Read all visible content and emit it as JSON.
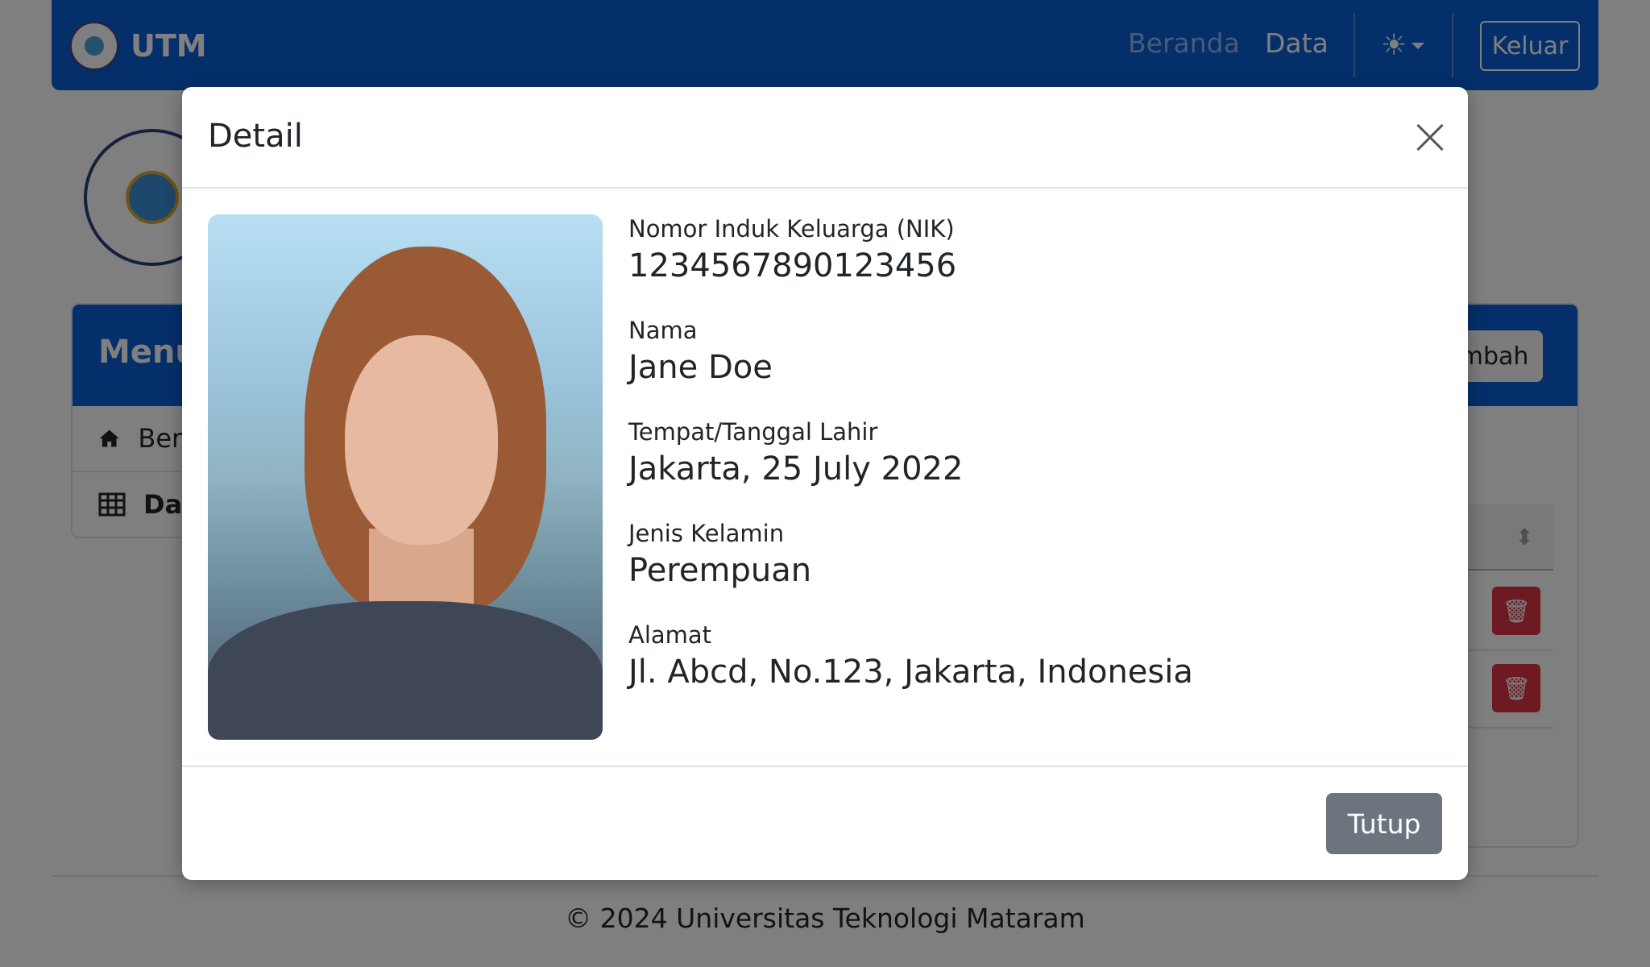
{
  "navbar": {
    "brand": "UTM",
    "links": [
      {
        "label": "Beranda"
      },
      {
        "label": "Data"
      }
    ],
    "logout_label": "Keluar",
    "icons": {
      "theme": "sun-icon",
      "caret": "caret-down-icon"
    }
  },
  "sidebar": {
    "title": "Menu",
    "items": [
      {
        "label": "Beranda",
        "icon": "home-icon"
      },
      {
        "label": "Data",
        "icon": "table-grid-icon"
      }
    ]
  },
  "main": {
    "add_label": "Tambah"
  },
  "footer": {
    "text": "© 2024 Universitas Teknologi Mataram"
  },
  "modal": {
    "title": "Detail",
    "fields": [
      {
        "label": "Nomor Induk Keluarga (NIK)",
        "value": "1234567890123456"
      },
      {
        "label": "Nama",
        "value": "Jane Doe"
      },
      {
        "label": "Tempat/Tanggal Lahir",
        "value": "Jakarta, 25 July 2022"
      },
      {
        "label": "Jenis Kelamin",
        "value": "Perempuan"
      },
      {
        "label": "Alamat",
        "value": "Jl. Abcd, No.123, Jakarta, Indonesia"
      }
    ],
    "close_label": "Tutup"
  },
  "colors": {
    "primary": "#0b5ed7",
    "danger": "#dc3545",
    "secondary": "#6c757d"
  }
}
